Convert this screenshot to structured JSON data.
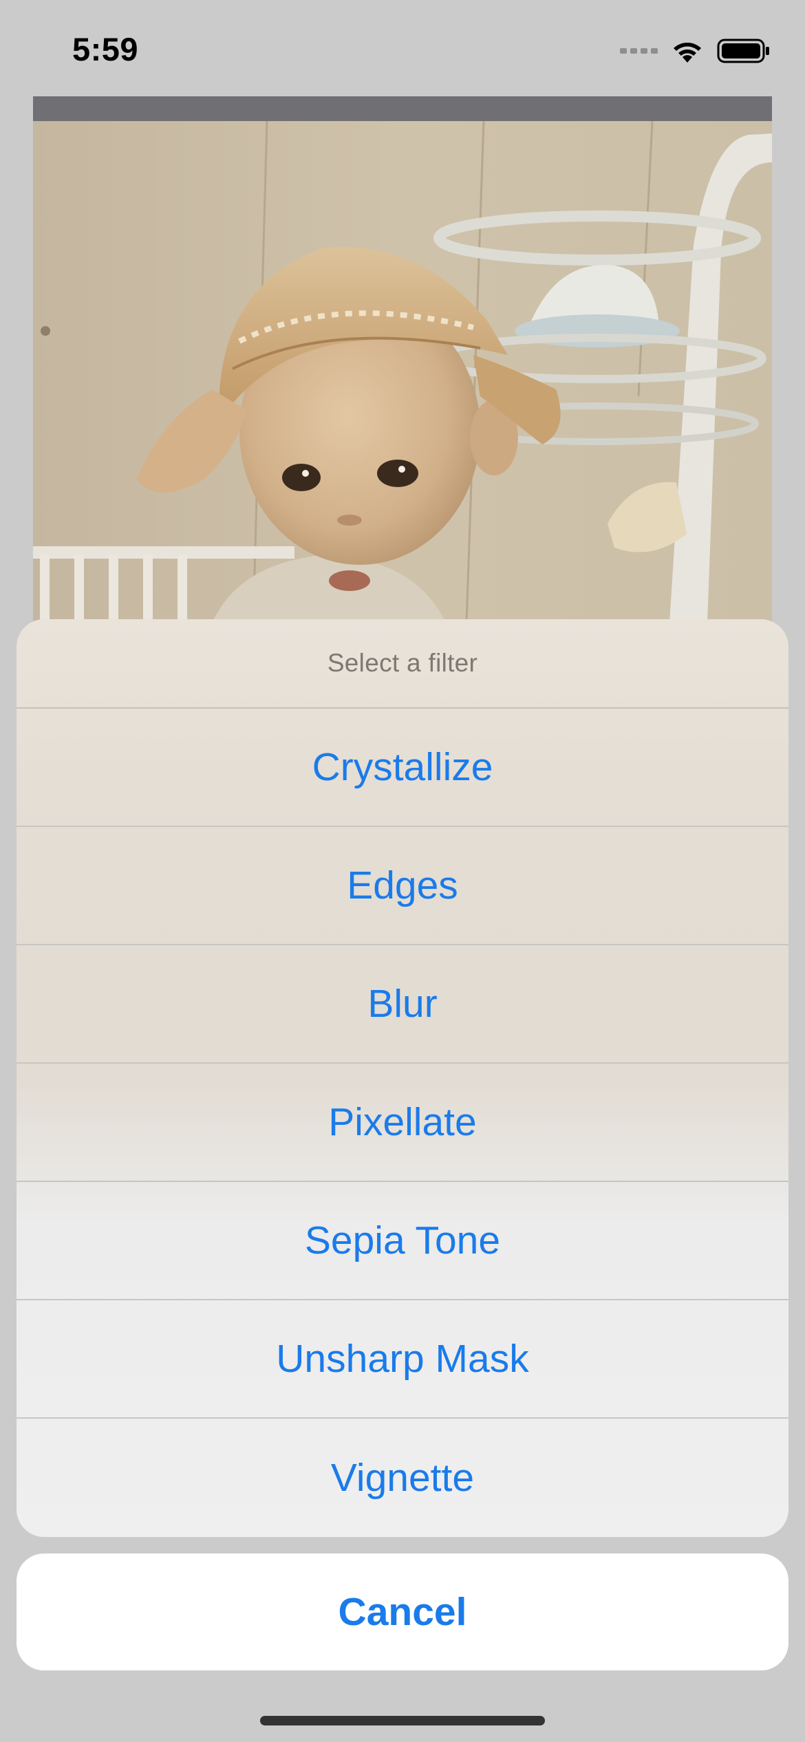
{
  "status_bar": {
    "time": "5:59",
    "icons": [
      "cellular-signal-icon",
      "wifi-icon",
      "battery-icon"
    ]
  },
  "photo": {
    "icon": "photo-image"
  },
  "action_sheet": {
    "title": "Select a filter",
    "options": [
      {
        "label": "Crystallize"
      },
      {
        "label": "Edges"
      },
      {
        "label": "Blur"
      },
      {
        "label": "Pixellate"
      },
      {
        "label": "Sepia Tone"
      },
      {
        "label": "Unsharp Mask"
      },
      {
        "label": "Vignette"
      }
    ],
    "cancel_label": "Cancel"
  },
  "colors": {
    "accent": "#1a7bea",
    "background": "#cbcbcb",
    "title_text": "#7d7870"
  }
}
